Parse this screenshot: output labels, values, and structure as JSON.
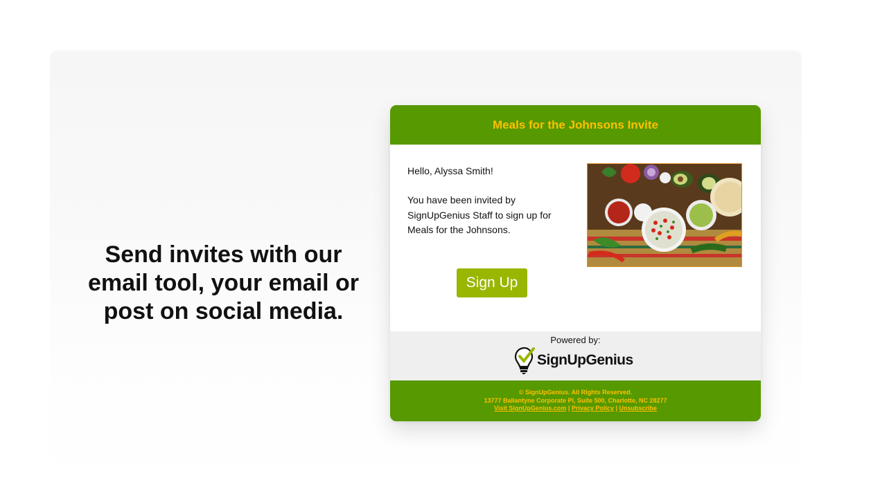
{
  "tagline": {
    "line1": "Send invites with our",
    "line2": "email tool, your email or",
    "line3": "post on social media."
  },
  "email": {
    "title": "Meals for the Johnsons Invite",
    "greeting": "Hello, Alyssa Smith!",
    "message": "You have been invited by SignUpGenius Staff to sign up for Meals for the Johnsons.",
    "signup_label": "Sign Up",
    "powered_by": "Powered by:",
    "logo_text": "SignUpGenius",
    "footer": {
      "copyright": "© SignUpGenius. All Rights Reserved.",
      "address": "13777 Ballantyne Corporate Pl, Suite 500, Charlotte, NC 28277",
      "link_visit": "Visit SignUpGenius.com",
      "sep1": " | ",
      "link_privacy": "Privacy Policy",
      "sep2": " | ",
      "link_unsubscribe": "Unsubscribe"
    }
  },
  "colors": {
    "header_green": "#569900",
    "title_gold": "#ffc000",
    "button_green": "#99b600",
    "powered_gray": "#efefef"
  },
  "icons": {
    "logo": "lightbulb-checkmark-icon",
    "image": "salsa-vegetables-photo"
  }
}
